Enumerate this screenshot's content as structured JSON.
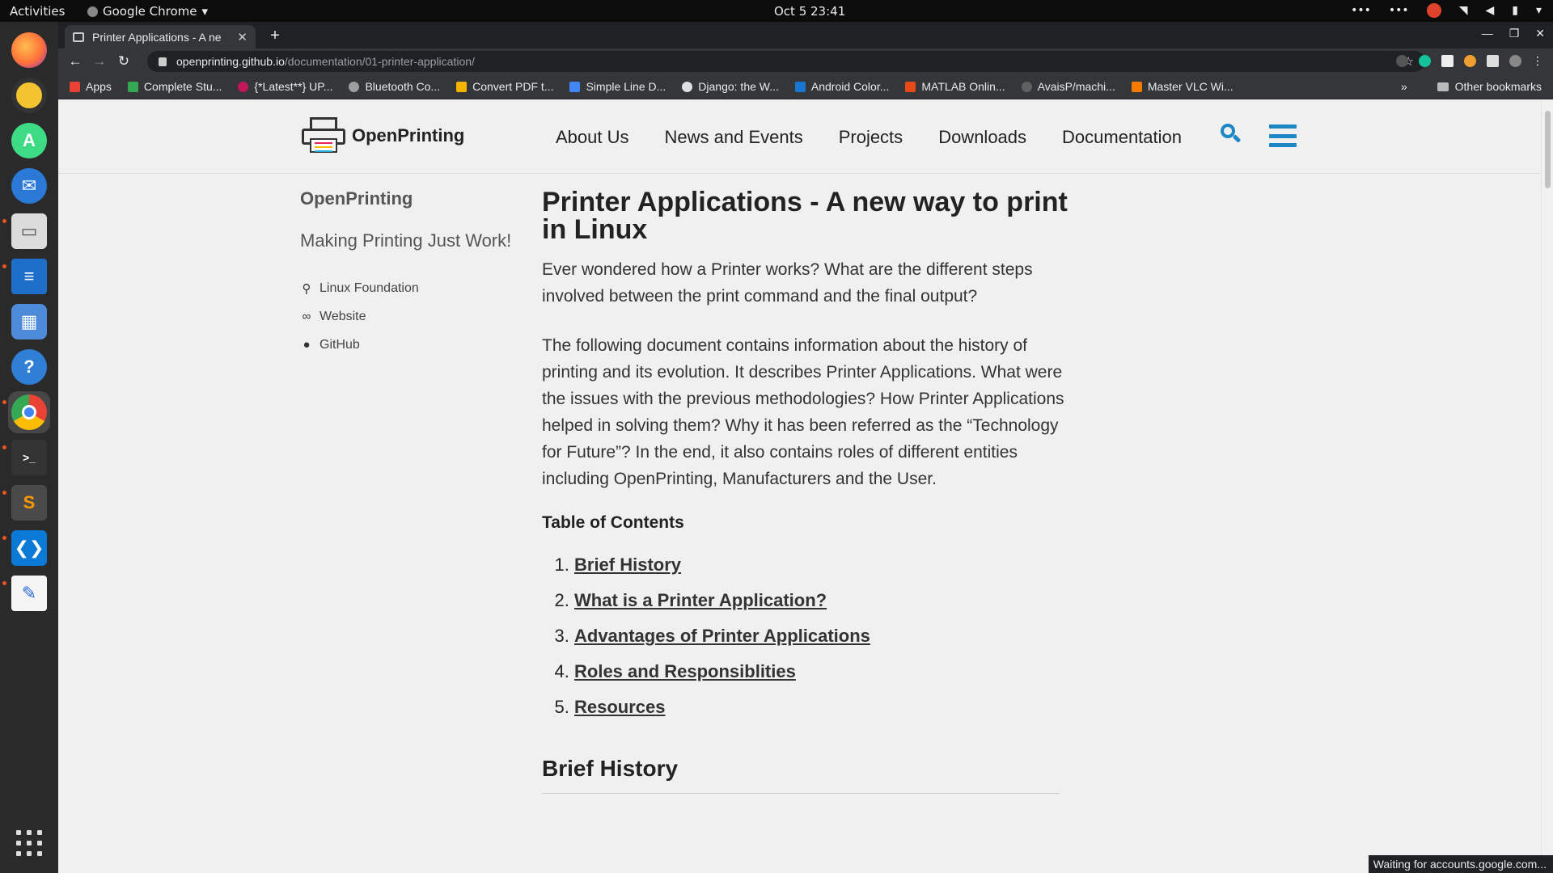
{
  "topbar": {
    "activities": "Activities",
    "app_name": "Google Chrome",
    "app_dropdown": "▾",
    "clock": "Oct 5  23:41",
    "tray_more": "•••"
  },
  "browser": {
    "tab_title": "Printer Applications - A ne",
    "tab_close": "✕",
    "new_tab": "+",
    "url_host": "openprinting.github.io",
    "url_path": "/documentation/01-printer-application/",
    "bookmarks": [
      {
        "label": "Apps",
        "color": "#e94235"
      },
      {
        "label": "Complete Stu...",
        "color": "#34a853"
      },
      {
        "label": "{*Latest**} UP...",
        "color": "#c2185b"
      },
      {
        "label": "Bluetooth Co...",
        "color": "#9e9e9e"
      },
      {
        "label": "Convert PDF t...",
        "color": "#f4b400"
      },
      {
        "label": "Simple Line D...",
        "color": "#4285f4"
      },
      {
        "label": "Django: the W...",
        "color": "#e0e0e0"
      },
      {
        "label": "Android Color...",
        "color": "#1976d2"
      },
      {
        "label": "MATLAB Onlin...",
        "color": "#e64a19"
      },
      {
        "label": "AvaisP/machi...",
        "color": "#616161"
      },
      {
        "label": "Master VLC Wi...",
        "color": "#f57c00"
      }
    ],
    "bookmarks_more": "»",
    "other_bookmarks": "Other bookmarks",
    "status_text": "Waiting for accounts.google.com..."
  },
  "site": {
    "logo_text": "OpenPrinting",
    "nav": [
      "About Us",
      "News and Events",
      "Projects",
      "Downloads",
      "Documentation"
    ],
    "accent_color": "#1e88c7"
  },
  "sidebar": {
    "title": "OpenPrinting",
    "tagline": "Making Printing Just Work!",
    "links": [
      {
        "label": "Linux Foundation",
        "icon": "map-marker-icon"
      },
      {
        "label": "Website",
        "icon": "link-icon"
      },
      {
        "label": "GitHub",
        "icon": "github-icon"
      }
    ]
  },
  "article": {
    "title": "Printer Applications - A new way to print in Linux",
    "intro": "Ever wondered how a Printer works? What are the different steps involved between the print command and the final output?",
    "description": "The following document contains information about the history of printing and its evolution. It describes Printer Applications. What were the issues with the previous methodologies? How Printer Applications helped in solving them? Why it has been referred as the “Technology for Future”? In the end, it also contains roles of different entities including OpenPrinting, Manufacturers and the User.",
    "toc_title": "Table of Contents",
    "toc": [
      "Brief History",
      "What is a Printer Application?",
      "Advantages of Printer Applications",
      "Roles and Responsiblities",
      "Resources"
    ],
    "section_heading": "Brief History"
  }
}
